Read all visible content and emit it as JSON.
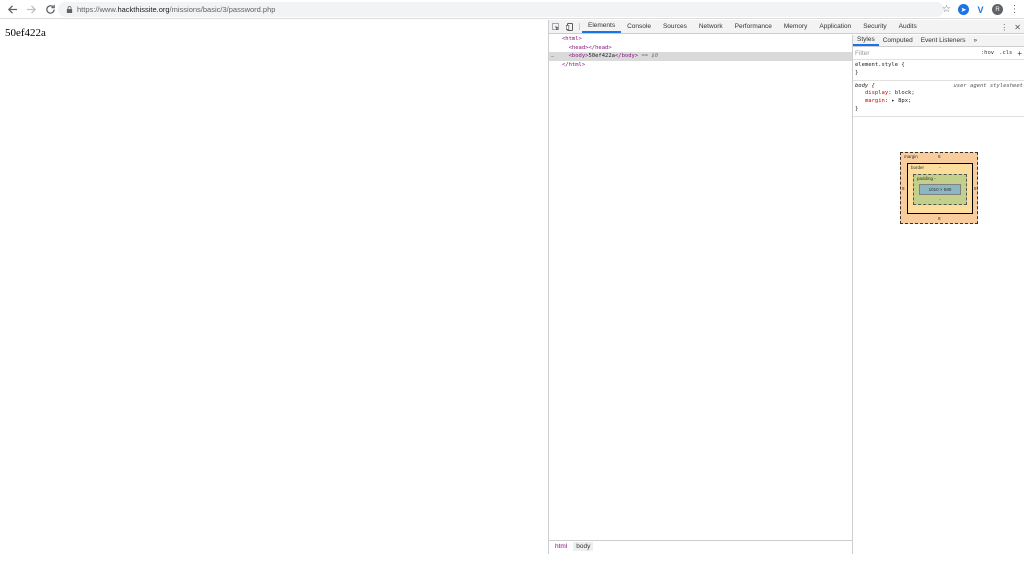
{
  "browser": {
    "url_prefix": "https://www.",
    "url_host": "hackthissite.org",
    "url_path": "/missions/basic/3/password.php",
    "avatar_letter": "R"
  },
  "page": {
    "text": "50ef422a"
  },
  "devtools": {
    "tabs": [
      "Elements",
      "Console",
      "Sources",
      "Network",
      "Performance",
      "Memory",
      "Application",
      "Security",
      "Audits"
    ],
    "active_tab": "Elements",
    "dom": {
      "html_open": "<html>",
      "head": "<head></head>",
      "body_open": "<body>",
      "body_text": "50ef422a",
      "body_close": "</body>",
      "eq_text": "== $0",
      "html_close": "</html>",
      "dots": "…"
    },
    "breadcrumb": [
      "html",
      "body"
    ],
    "styles": {
      "tabs": [
        "Styles",
        "Computed",
        "Event Listeners",
        "»"
      ],
      "filter_placeholder": "Filter",
      "hov": ":hov",
      "cls": ".cls",
      "plus": "+",
      "element_style": "element.style {",
      "close_brace": "}",
      "body_selector": "body {",
      "body_source": "user agent stylesheet",
      "prop1_name": "display",
      "prop1_value": "block;",
      "prop2_name": "margin",
      "prop2_value": "8px;"
    },
    "box_model": {
      "margin_label": "margin",
      "margin_value": "8",
      "border_label": "border",
      "border_value": "-",
      "padding_label": "padding -",
      "content_size": "1010 × 580",
      "side_value": "8",
      "dash": "-"
    }
  }
}
